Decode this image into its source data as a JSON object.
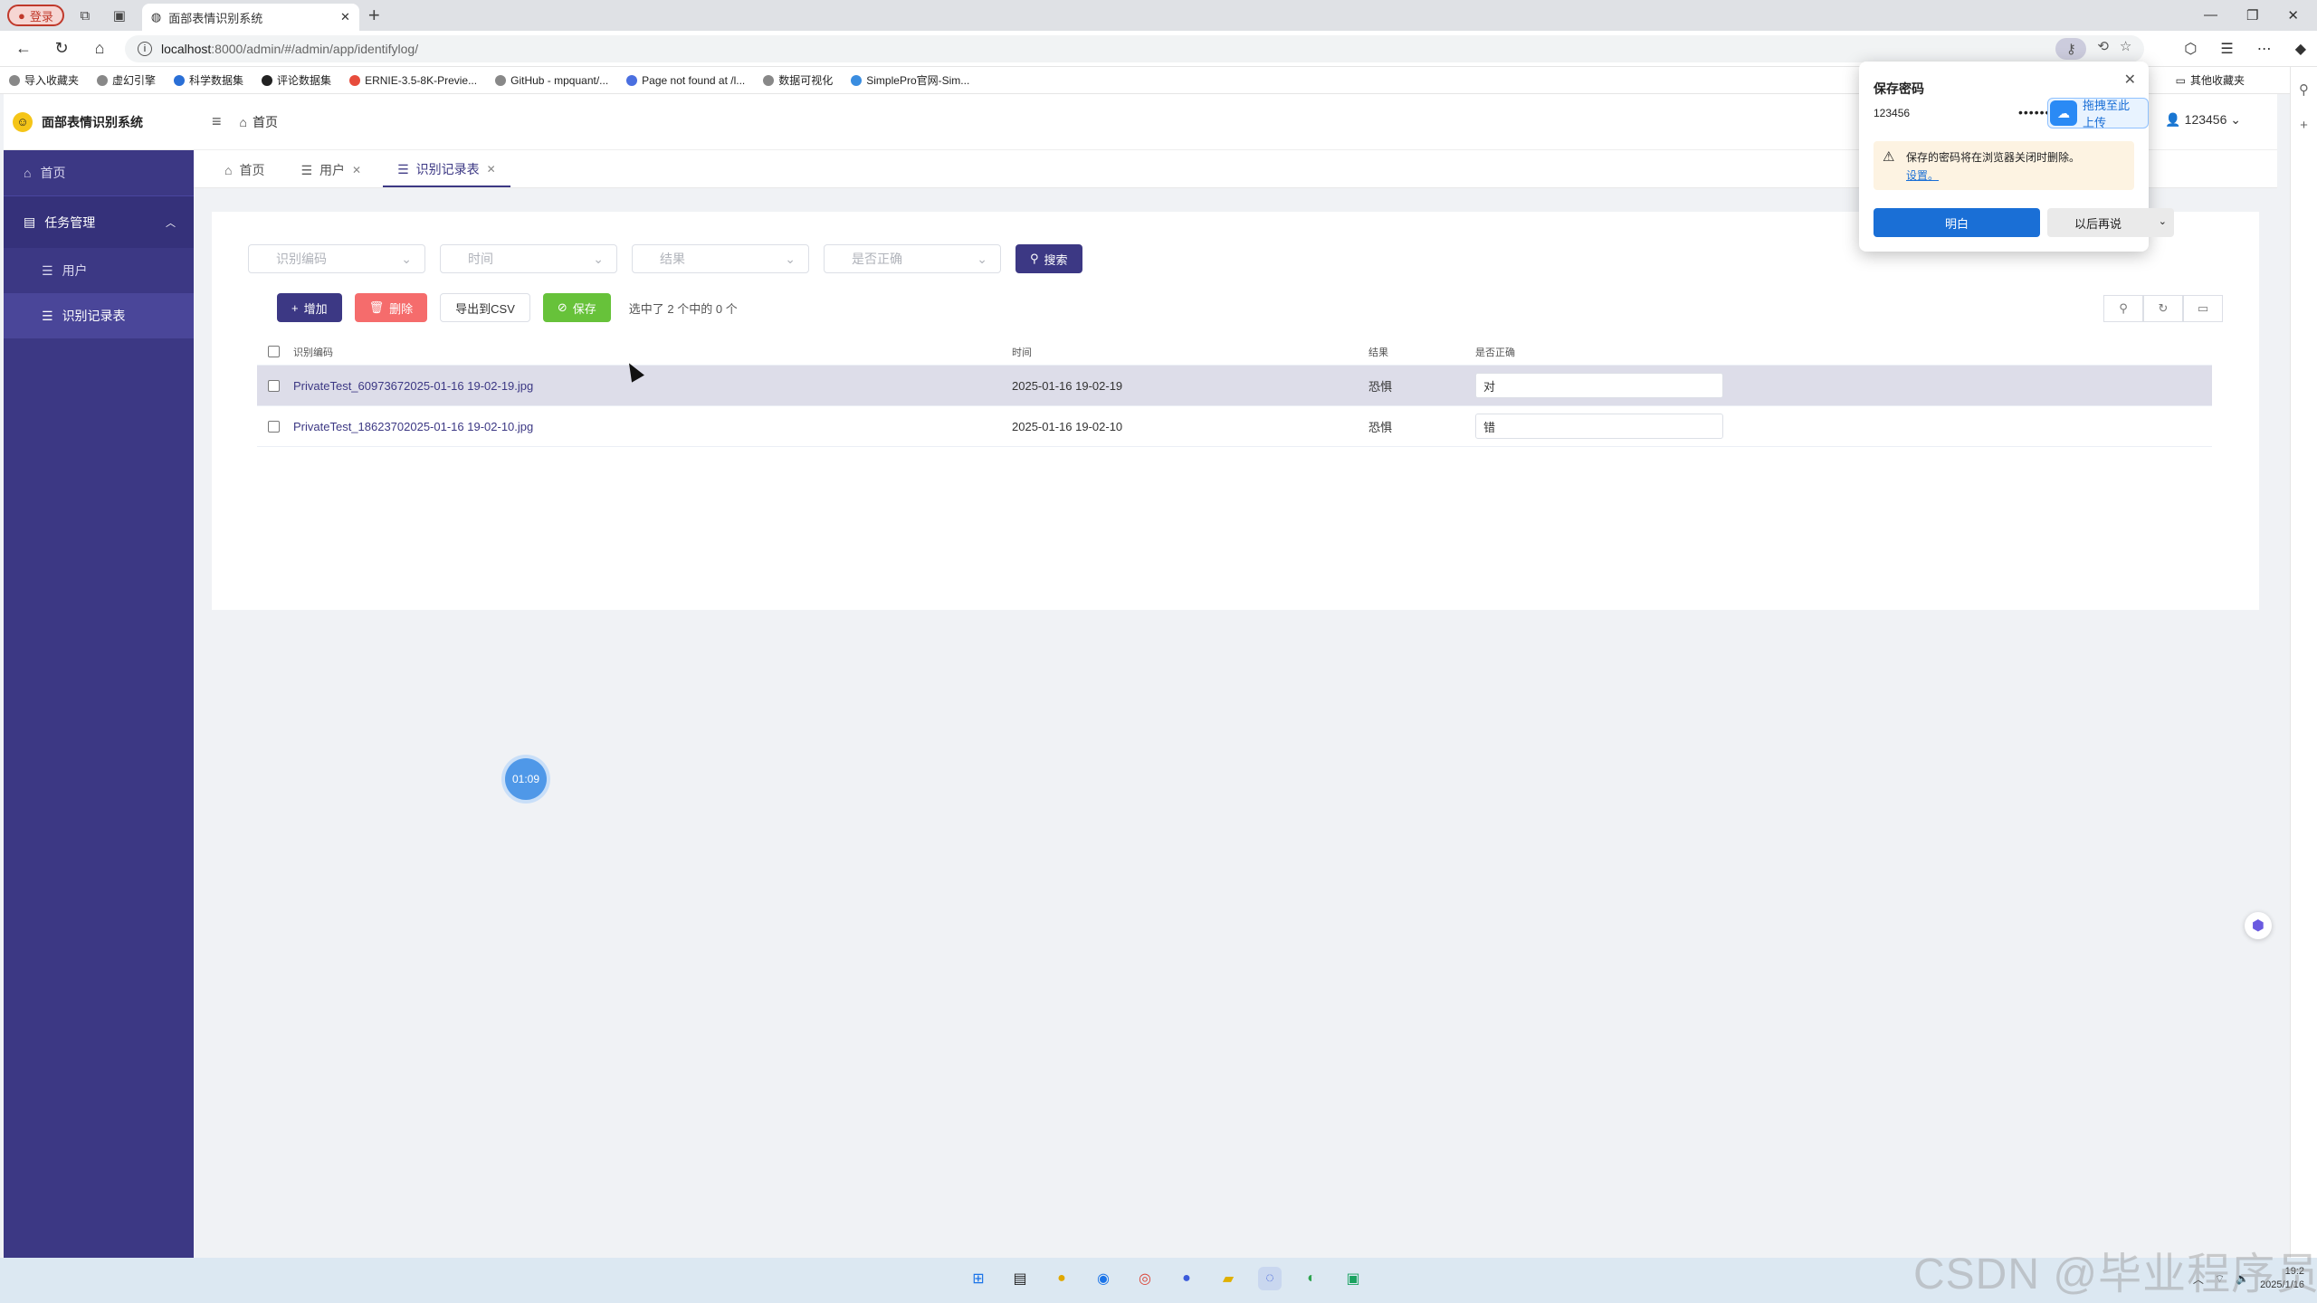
{
  "browser": {
    "profile_label": "登录",
    "tab_title": "面部表情识别系统",
    "url_host": "localhost",
    "url_rest": ":8000/admin/#/admin/app/identifylog/",
    "bookmarks": [
      "导入收藏夹",
      "虚幻引擎",
      "科学数据集",
      "评论数据集",
      "ERNIE-3.5-8K-Previe...",
      "GitHub - mpquant/...",
      "Page not found at /l...",
      "数据可视化",
      "SimplePro官网-Sim..."
    ],
    "bookmarks_other": "其他收藏夹"
  },
  "app": {
    "title": "面部表情识别系统",
    "breadcrumb_home": "首页",
    "user_name": "123456"
  },
  "sidebar": {
    "home": "首页",
    "group": "任务管理",
    "items": [
      "用户",
      "识别记录表"
    ]
  },
  "page_tabs": [
    {
      "label": "首页"
    },
    {
      "label": "用户"
    },
    {
      "label": "识别记录表"
    }
  ],
  "filters": {
    "code_placeholder": "识别编码",
    "time_placeholder": "时间",
    "result_placeholder": "结果",
    "correct_placeholder": "是否正确",
    "search_label": "搜索"
  },
  "toolbar": {
    "add_label": "增加",
    "delete_label": "删除",
    "export_label": "导出到CSV",
    "save_label": "保存",
    "selection_info": "选中了 2 个中的 0 个"
  },
  "table": {
    "headers": [
      "识别编码",
      "时间",
      "结果",
      "是否正确"
    ],
    "rows": [
      {
        "code": "PrivateTest_60973672025-01-16 19-02-19.jpg",
        "time": "2025-01-16 19-02-19",
        "result": "恐惧",
        "correct": "对"
      },
      {
        "code": "PrivateTest_18623702025-01-16 19-02-10.jpg",
        "time": "2025-01-16 19-02-10",
        "result": "恐惧",
        "correct": "错"
      }
    ]
  },
  "timer": "01:09",
  "password_popup": {
    "title": "保存密码",
    "username": "123456",
    "password_mask": "••••••",
    "upload_label": "拖拽至此上传",
    "warning": "保存的密码将在浏览器关闭时删除。",
    "warning_link": "设置。",
    "ok_label": "明白",
    "later_label": "以后再说"
  },
  "taskbar": {
    "time": "19:2",
    "date": "2025/1/16"
  },
  "watermark": "CSDN @毕业程序员"
}
